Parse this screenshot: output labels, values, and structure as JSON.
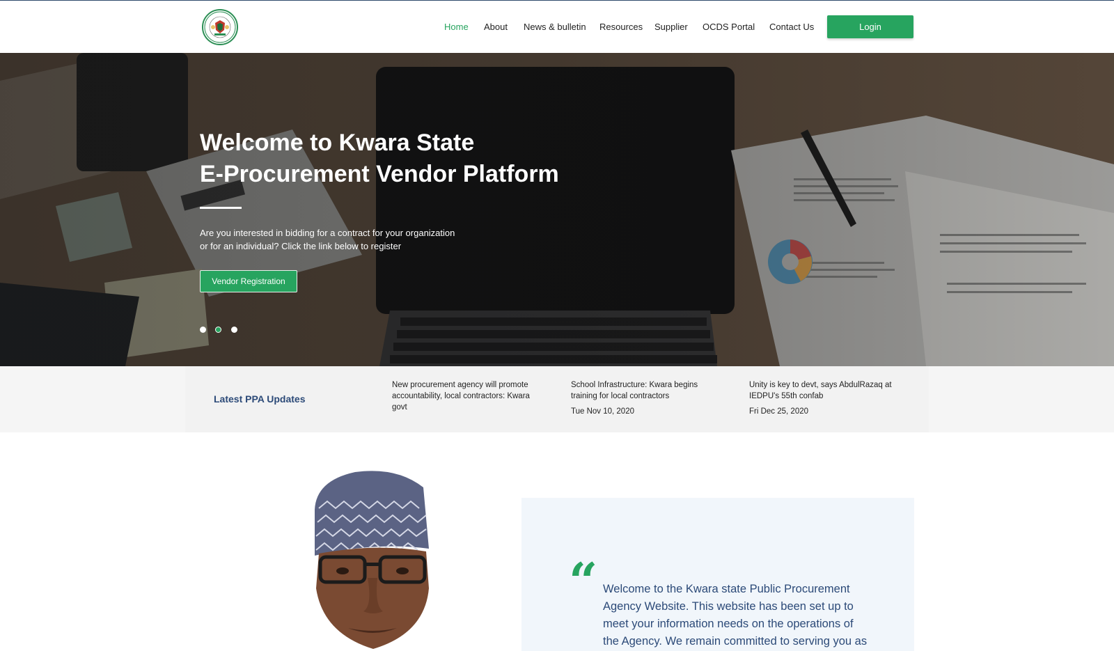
{
  "header": {
    "logo_name": "kwara-state-coat-of-arms",
    "nav": [
      {
        "label": "Home",
        "active": true
      },
      {
        "label": "About",
        "active": false
      },
      {
        "label": "News & bulletin",
        "active": false
      },
      {
        "label": "Resources",
        "active": false
      },
      {
        "label": "Supplier",
        "active": false
      },
      {
        "label": "OCDS Portal",
        "active": false
      },
      {
        "label": "Contact Us",
        "active": false
      }
    ],
    "login_label": "Login"
  },
  "hero": {
    "title_line1": "Welcome to Kwara State",
    "title_line2": "E-Procurement Vendor Platform",
    "text_line1": "Are you interested in bidding for a contract for your organization",
    "text_line2": "or for an individual? Click the link below to register",
    "cta_label": "Vendor Registration",
    "slide_count": 3,
    "active_slide": 2
  },
  "updates": {
    "title": "Latest PPA Updates",
    "items": [
      {
        "headline": "New procurement agency will promote accountability, local contractors: Kwara govt",
        "date": ""
      },
      {
        "headline": "School Infrastructure: Kwara begins training for local contractors",
        "date": "Tue Nov 10, 2020"
      },
      {
        "headline": "Unity is key to devt, says AbdulRazaq at IEDPU's 55th confab",
        "date": "Fri Dec 25, 2020"
      }
    ]
  },
  "welcome": {
    "quote_mark": "“",
    "lines": [
      "Welcome to the Kwara state Public Procurement",
      "Agency Website. This website has been set up to",
      "meet your information needs on the operations of",
      "the Agency. We remain committed to serving you as"
    ]
  },
  "colors": {
    "accent": "#27a45f",
    "navy": "#2c4a78",
    "updates_bg": "#f2f2f2",
    "quote_bg": "#f1f6fb"
  }
}
